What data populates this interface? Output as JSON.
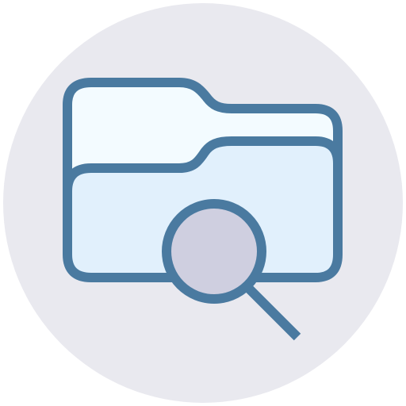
{
  "icon": {
    "name": "folder-search-icon",
    "colors": {
      "background": "#e9e9ef",
      "stroke": "#4a7aa0",
      "folder_back_fill": "#f3fbff",
      "folder_front_fill": "#e1f0fc",
      "lens_fill": "#cfcfe0"
    }
  }
}
